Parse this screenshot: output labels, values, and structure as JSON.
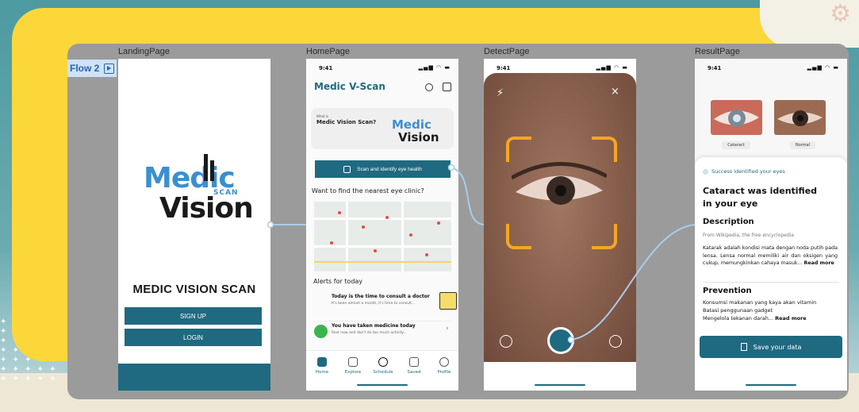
{
  "flow": {
    "tag": "Flow 2"
  },
  "frames": {
    "landing": "LandingPage",
    "home": "HomePage",
    "detect": "DetectPage",
    "result": "ResultPage"
  },
  "landing": {
    "logo_line1": "Medic",
    "logo_line2": "Vision",
    "logo_scan": "SCAN",
    "title": "MEDIC VISION SCAN",
    "signup_label": "SIGN UP",
    "login_label": "LOGIN"
  },
  "home": {
    "time": "9:41",
    "app_title": "Medic V-Scan",
    "banner_small": "What is",
    "banner_question": "Medic Vision Scan?",
    "banner_logo1": "Medic",
    "banner_logo2": "Vision",
    "scan_button": "Scan and identify eye health",
    "clinic_question": "Want to find the nearest eye clinic?",
    "alerts_heading": "Alerts for today",
    "alerts": [
      {
        "title": "Today is the time to consult a doctor",
        "subtitle": "It's been almost a month, it's time to consult..."
      },
      {
        "title": "You have taken medicine today",
        "subtitle": "Rest now and don't do too much activity..."
      }
    ],
    "nav": [
      "Home",
      "Explore",
      "Schedule",
      "Saved",
      "Profile"
    ]
  },
  "detect": {
    "time": "9:41"
  },
  "result": {
    "time": "9:41",
    "image_labels": [
      "Cataract",
      "Normal"
    ],
    "success_text": "Success identified your eyes",
    "heading_line1": "Cataract was identified",
    "heading_line2": "in your eye",
    "description_title": "Description",
    "description_source": "From Wikipedia, the free encyclopedia",
    "description_body": "Katarak adalah kondisi mata dengan noda putih pada lensa. Lensa normal memiliki air dan oksigen yang cukup, memungkinkan cahaya masuk...",
    "read_more": "Read more",
    "prevention_title": "Prevention",
    "prevention_items": [
      "Konsumsi makanan yang kaya akan vitamin",
      "Batasi penggunaan gadget",
      "Mengelola tekanan darah..."
    ],
    "save_label": "Save your data"
  },
  "colors": {
    "primary": "#1f6a80",
    "accent_yellow": "#fcd73a",
    "scan_frame": "#f5a623",
    "logo_blue": "#3b8fd0"
  }
}
